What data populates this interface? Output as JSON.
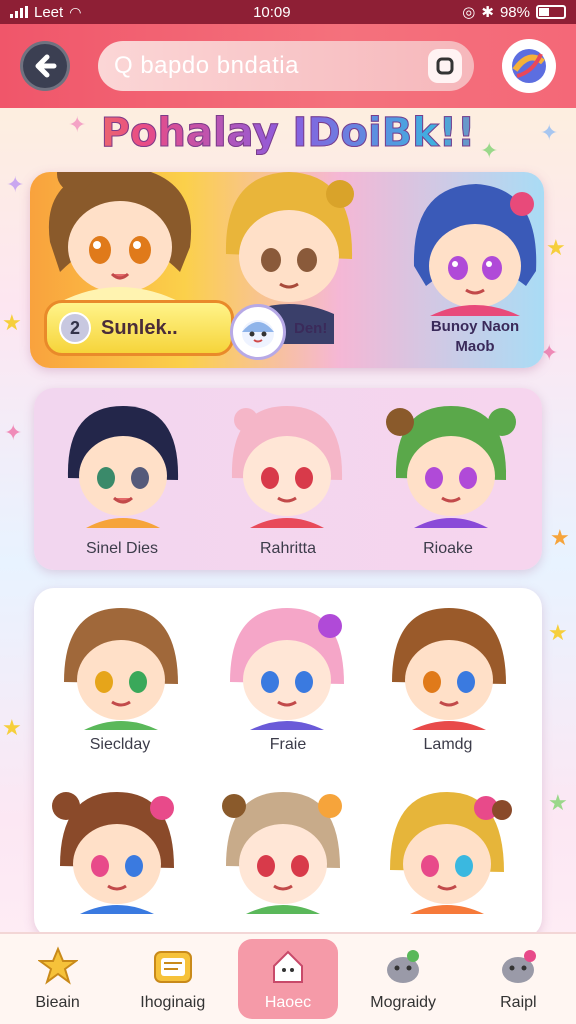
{
  "status_bar": {
    "carrier": "Leet",
    "time": "10:09",
    "battery": "98%"
  },
  "header": {
    "search_text": "Q bapdo bndatia"
  },
  "title": "Pohalay IDoiBk!!",
  "hero": {
    "badge_number": "2",
    "badge_label": "Sunlek..",
    "mascot_label": "Den!",
    "right_label_line1": "Bunoy Naon",
    "right_label_line2": "Maob"
  },
  "row_one": [
    {
      "label": "Sinel Dies"
    },
    {
      "label": "Rahritta"
    },
    {
      "label": "Rioake"
    }
  ],
  "grid": [
    {
      "label": "Sieclday"
    },
    {
      "label": "Fraie"
    },
    {
      "label": "Lamdg"
    }
  ],
  "nav": [
    {
      "label": "Bieain",
      "icon": "star-icon"
    },
    {
      "label": "Ihoginaig",
      "icon": "note-icon"
    },
    {
      "label": "Haoec",
      "icon": "home-icon"
    },
    {
      "label": "Mograidy",
      "icon": "monster-icon"
    },
    {
      "label": "Raipl",
      "icon": "creature-icon"
    }
  ],
  "colors": {
    "header": "#f0566a",
    "status_bar": "#8e1f35",
    "nav_active": "#f59aa8"
  }
}
